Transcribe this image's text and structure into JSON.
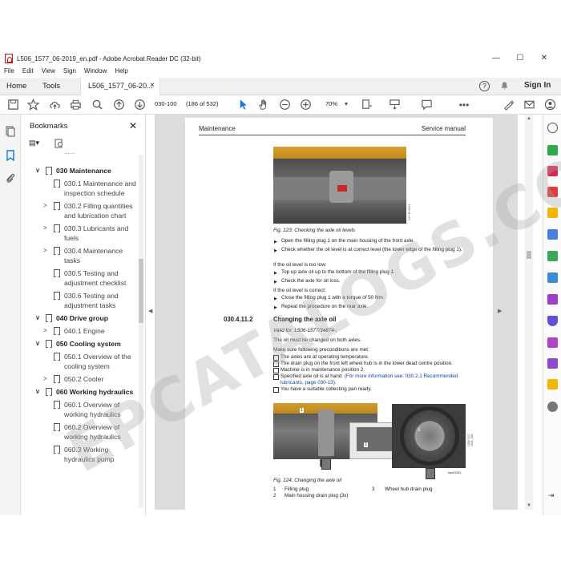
{
  "window": {
    "title": "L506_1577_06-2019_en.pdf - Adobe Acrobat Reader DC (32-bit)",
    "min": "—",
    "max": "☐",
    "close": "✕"
  },
  "menu": [
    "File",
    "Edit",
    "View",
    "Sign",
    "Window",
    "Help"
  ],
  "tabs": {
    "home": "Home",
    "tools": "Tools",
    "doc": "L506_1577_06-20...",
    "doc_close": "×",
    "signin": "Sign In"
  },
  "toolbar": {
    "page_input": "030-100",
    "page_count": "(186 of 532)",
    "zoom": "70%"
  },
  "bookmarks": {
    "title": "Bookmarks",
    "close": "✕",
    "items": [
      {
        "label": "030 Maintenance",
        "level": 1,
        "chev": "∨"
      },
      {
        "label": "030.1 Maintenance and inspection schedule",
        "level": 2,
        "chev": ""
      },
      {
        "label": "030.2 Filling quantities and lubrication chart",
        "level": 2,
        "chev": ">"
      },
      {
        "label": "030.3 Lubricants and fuels",
        "level": 2,
        "chev": ">"
      },
      {
        "label": "030.4 Maintenance tasks",
        "level": 2,
        "chev": ">"
      },
      {
        "label": "030.5 Testing and adjustment checklist",
        "level": 2,
        "chev": ""
      },
      {
        "label": "030.6 Testing and adjustment tasks",
        "level": 2,
        "chev": ""
      },
      {
        "label": "040 Drive group",
        "level": 1,
        "chev": "∨"
      },
      {
        "label": "040.1 Engine",
        "level": 2,
        "chev": ">"
      },
      {
        "label": "050 Cooling system",
        "level": 1,
        "chev": "∨"
      },
      {
        "label": "050.1 Overview of the cooling system",
        "level": 2,
        "chev": ""
      },
      {
        "label": "050.2 Cooler",
        "level": 2,
        "chev": ">"
      },
      {
        "label": "060 Working hydraulics",
        "level": 1,
        "chev": "∨"
      },
      {
        "label": "060.1 Overview of working hydraulics",
        "level": 2,
        "chev": ""
      },
      {
        "label": "060.2 Overview of working hydraulics",
        "level": 2,
        "chev": ""
      },
      {
        "label": "060.3 Working hydraulics pump",
        "level": 2,
        "chev": ""
      }
    ]
  },
  "page": {
    "header_left": "Maintenance",
    "header_right": "Service manual",
    "fig123_caption": "Fig. 123: Checking the axle oil levels",
    "fig123_code": "LS7 56 0031",
    "step1": "Open the filling plug 1 on the main housing of the front axle.",
    "step2": "Check whether the oil level is at correct level (the lower edge of the filling plug 1).",
    "if_low": "If the oil level is too low:",
    "step3": "Top up axle oil up to the bottom of the filling plug 1.",
    "step4": "Check the axle for oil loss.",
    "if_correct": "If the oil level is correct:",
    "step5": "Close the filling plug 1 with a torque of 50 Nm.",
    "step6": "Repeat the procedure on the rear axle.",
    "section_no": "030.4.11.2",
    "section_title": "Changing the axle oil",
    "valid_for": "Valid for: L506-1577/34874-;",
    "oil_note": "The oil must be changed on both axles.",
    "precond": "Make sure following preconditions are met:",
    "c1": "The axles are at operating temperature.",
    "c2": "The drain plug on the front left wheel hub is in the lower dead centre position.",
    "c3": "Machine is in maintenance position 2.",
    "c4_a": "Specified axle oil is at hand.",
    "c4_link": "(For more information see: 030.2.1 Recommended lubricants, page 030-13).",
    "c5": "You have a suitable collecting pan ready.",
    "fig124_caption": "Fig. 124: Changing the axle oil",
    "fig124_code": "L506 SS7 1011_001",
    "img_code": "ssm01204",
    "legend1_no": "1",
    "legend1": "Filling plug",
    "legend2_no": "2",
    "legend2": "Main housing drain plug (3x)",
    "legend3_no": "3",
    "legend3": "Wheel hub drain plug",
    "callout1": "1",
    "callout2": "2",
    "callout3": "3"
  },
  "watermark": "EPCATALOGS.COM",
  "colors": {
    "accent": "#1473e6",
    "brand": "#c4161c",
    "link": "#0b43a6"
  }
}
